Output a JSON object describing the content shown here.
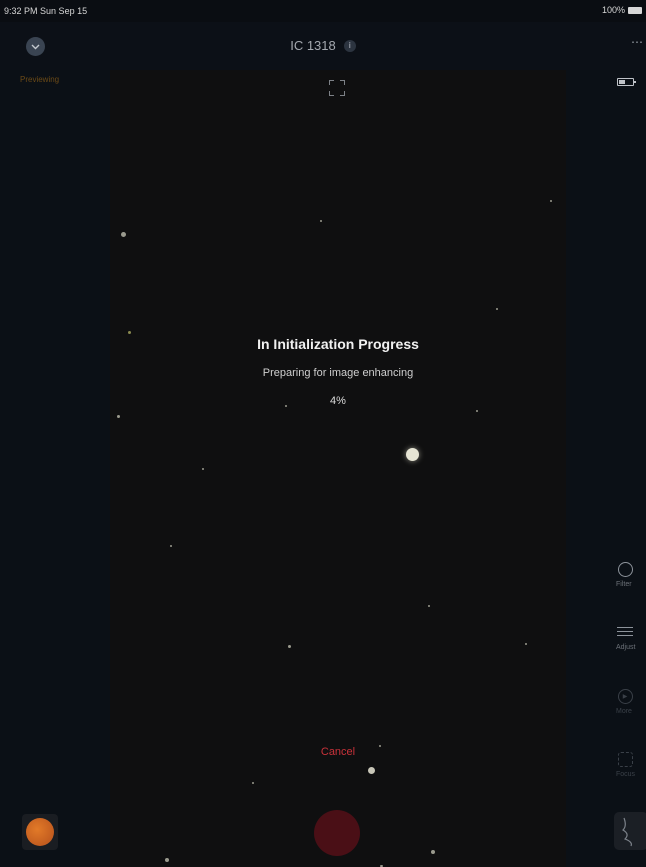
{
  "status_bar": {
    "time": "9:32 PM",
    "date": "Sun Sep 15",
    "battery": "100%"
  },
  "header": {
    "title": "IC 1318",
    "info_icon": "info-icon",
    "more_icon": "more-icon"
  },
  "left_panel": {
    "mode_label": "Previewing"
  },
  "progress": {
    "title": "In Initialization Progress",
    "subtitle": "Preparing for image enhancing",
    "percent": "4%",
    "percent_value": 0.04
  },
  "actions": {
    "cancel_label": "Cancel"
  },
  "tools": [
    {
      "label": "Filter",
      "icon": "filter-icon"
    },
    {
      "label": "Adjust",
      "icon": "adjust-icon"
    },
    {
      "label": "More",
      "icon": "play-icon"
    },
    {
      "label": "Focus",
      "icon": "focus-icon"
    }
  ],
  "colors": {
    "accent": "#c8323a",
    "preview_label": "#6b4a16",
    "shutter": "#4a0f16",
    "thumb": "#e27a28"
  }
}
